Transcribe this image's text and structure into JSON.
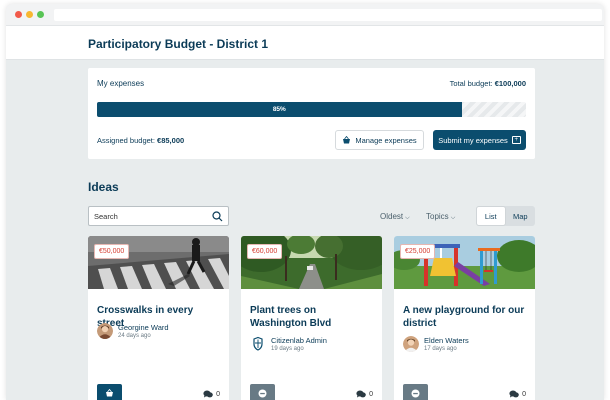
{
  "header": {
    "title": "Participatory Budget - District 1"
  },
  "budget": {
    "label": "My expenses",
    "total_label": "Total budget: ",
    "total_value": "€100,000",
    "progress_percent": 85,
    "progress_label": "85%",
    "assigned_label": "Assigned budget: ",
    "assigned_value": "€85,000",
    "manage_button": "Manage expenses",
    "submit_button": "Submit my expenses"
  },
  "ideas": {
    "title": "Ideas",
    "search_placeholder": "Search",
    "sort_label": "Oldest",
    "topics_label": "Topics",
    "view_list": "List",
    "view_map": "Map"
  },
  "cards": [
    {
      "price": "€50,000",
      "title": "Crosswalks in every street",
      "author": "Georgine Ward",
      "time": "24 days ago",
      "comments": "0",
      "vote": "added",
      "image": "street-crosswalk-photo",
      "avatar": "person-avatar"
    },
    {
      "price": "€60,000",
      "title": "Plant trees on Washington Blvd",
      "author": "Citizenlab Admin",
      "time": "19 days ago",
      "comments": "0",
      "vote": "remove",
      "image": "tree-lined-road-photo",
      "avatar": "shield-icon"
    },
    {
      "price": "€25,000",
      "title": "A new playground for our district",
      "author": "Elden Waters",
      "time": "17 days ago",
      "comments": "0",
      "vote": "remove",
      "image": "playground-photo",
      "avatar": "person-avatar"
    }
  ],
  "colors": {
    "primary": "#0b4d6e",
    "price": "#d43b2f",
    "background": "#e8eced"
  }
}
